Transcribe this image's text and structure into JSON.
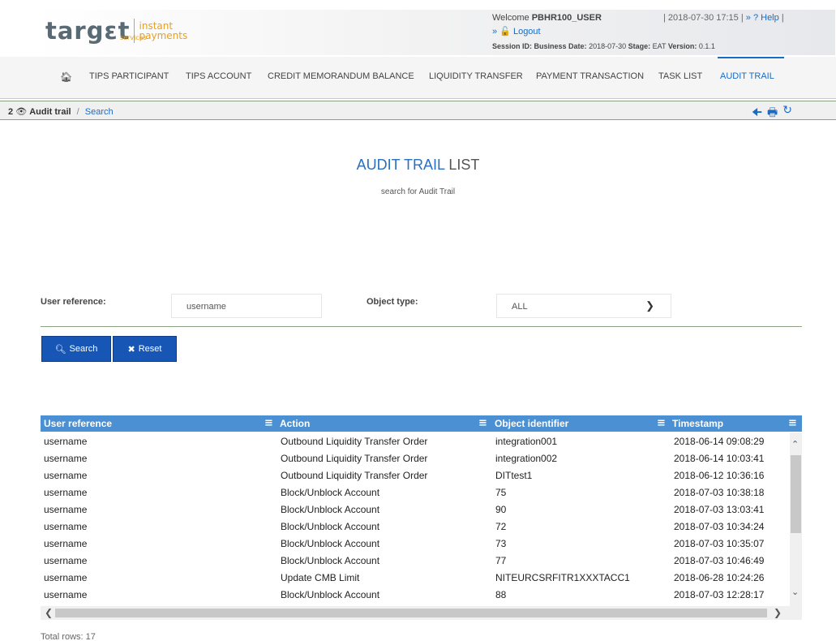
{
  "header": {
    "logo_word": "targɛt",
    "logo_services": "services",
    "logo_line1": "instant",
    "logo_line2": "payments",
    "welcome_prefix": "Welcome",
    "username": "PBHR100_USER",
    "date_text": "| 2018-07-30 17:15 |",
    "help_prefix": "»",
    "help_label": "Help",
    "help_suffix": "|",
    "logout_prefix": "»",
    "logout_label": "Logout",
    "session_label": "Session ID:",
    "business_date_label": "Business Date:",
    "business_date": "2018-07-30",
    "stage_label": "Stage:",
    "stage": "EAT",
    "version_label": "Version:",
    "version": "0.1.1"
  },
  "nav": {
    "items": [
      {
        "label": "TIPS PARTICIPANT"
      },
      {
        "label": "TIPS ACCOUNT"
      },
      {
        "label": "CREDIT MEMORANDUM BALANCE"
      },
      {
        "label": "LIQUIDITY TRANSFER"
      },
      {
        "label": "PAYMENT TRANSACTION"
      },
      {
        "label": "TASK LIST"
      },
      {
        "label": "AUDIT TRAIL"
      }
    ]
  },
  "breadcrumb": {
    "count": "2",
    "section": "Audit trail",
    "separator": "/",
    "current": "Search"
  },
  "page": {
    "title_blue": "AUDIT TRAIL",
    "title_rest": "LIST",
    "subtitle": "search for Audit Trail"
  },
  "form": {
    "user_reference_label": "User reference:",
    "user_reference_value": "username",
    "object_type_label": "Object type:",
    "object_type_value": "ALL",
    "search_label": "Search",
    "reset_label": "Reset"
  },
  "table": {
    "columns": [
      "User reference",
      "Action",
      "Object identifier",
      "Timestamp"
    ],
    "rows": [
      [
        "username",
        "Outbound Liquidity Transfer Order",
        "integration001",
        "2018-06-14 09:08:29"
      ],
      [
        "username",
        "Outbound Liquidity Transfer Order",
        "integration002",
        "2018-06-14 10:03:41"
      ],
      [
        "username",
        "Outbound Liquidity Transfer Order",
        "DITtest1",
        "2018-06-12 10:36:16"
      ],
      [
        "username",
        "Block/Unblock Account",
        "75",
        "2018-07-03 10:38:18"
      ],
      [
        "username",
        "Block/Unblock Account",
        "90",
        "2018-07-03 13:03:41"
      ],
      [
        "username",
        "Block/Unblock Account",
        "72",
        "2018-07-03 10:34:24"
      ],
      [
        "username",
        "Block/Unblock Account",
        "73",
        "2018-07-03 10:35:07"
      ],
      [
        "username",
        "Block/Unblock Account",
        "77",
        "2018-07-03 10:46:49"
      ],
      [
        "username",
        "Update CMB Limit",
        "NITEURCSRFITR1XXXTACC1",
        "2018-06-28 10:24:26"
      ],
      [
        "username",
        "Block/Unblock Account",
        "88",
        "2018-07-03 12:28:17"
      ]
    ],
    "total_rows": "Total rows: 17"
  },
  "colors": {
    "accent_blue": "#1a6bc4",
    "button_blue": "#1856b5",
    "grid_header": "#4a90d2",
    "logo_orange": "#e8a020"
  }
}
